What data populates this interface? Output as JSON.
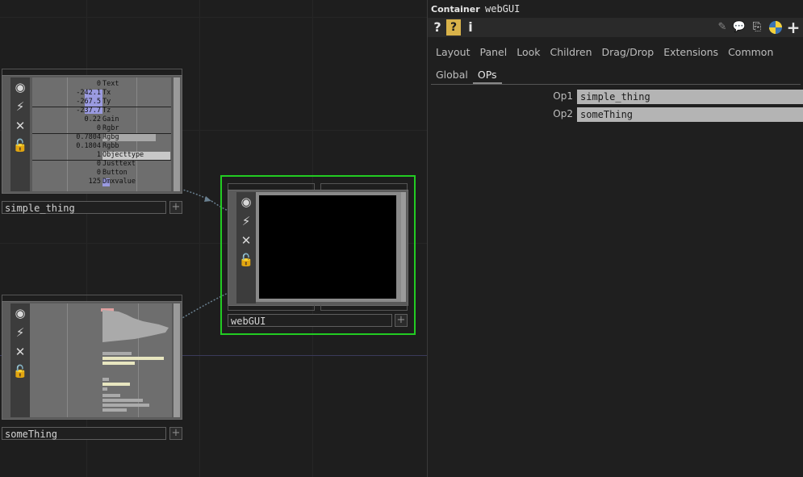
{
  "network": {
    "nodes": {
      "simple_thing": {
        "name": "simple_thing",
        "channels": [
          {
            "value": "0",
            "name": "Text"
          },
          {
            "value": "-242.1",
            "name": "Tx"
          },
          {
            "value": "-267.5",
            "name": "Ty"
          },
          {
            "value": "-237.7",
            "name": "Tz"
          },
          {
            "value": "0.22",
            "name": "Gain"
          },
          {
            "value": "0",
            "name": "Rgbr"
          },
          {
            "value": "0.7804",
            "name": "Rgbg"
          },
          {
            "value": "0.1804",
            "name": "Rgbb"
          },
          {
            "value": "1",
            "name": "Objecttype"
          },
          {
            "value": "0",
            "name": "Justtext"
          },
          {
            "value": "0",
            "name": "Button"
          },
          {
            "value": "125",
            "name": "Dmxvalue"
          }
        ]
      },
      "someThing": {
        "name": "someThing"
      },
      "webGUI": {
        "name": "webGUI",
        "selected_color": "#22cc22"
      }
    },
    "plus_glyph": "+"
  },
  "panel": {
    "type_label": "Container",
    "op_name": "webGUI",
    "toolbar": {
      "help_icon": "?",
      "python_help_icon": "?",
      "info_icon": "i",
      "plus_icon": "+"
    },
    "tabs": [
      "Layout",
      "Panel",
      "Look",
      "Children",
      "Drag/Drop",
      "Extensions",
      "Common"
    ],
    "subtabs": [
      {
        "label": "Global",
        "active": false
      },
      {
        "label": "OPs",
        "active": true
      }
    ],
    "params": [
      {
        "label": "Op1",
        "value": "simple_thing"
      },
      {
        "label": "Op2",
        "value": "someThing"
      }
    ]
  }
}
